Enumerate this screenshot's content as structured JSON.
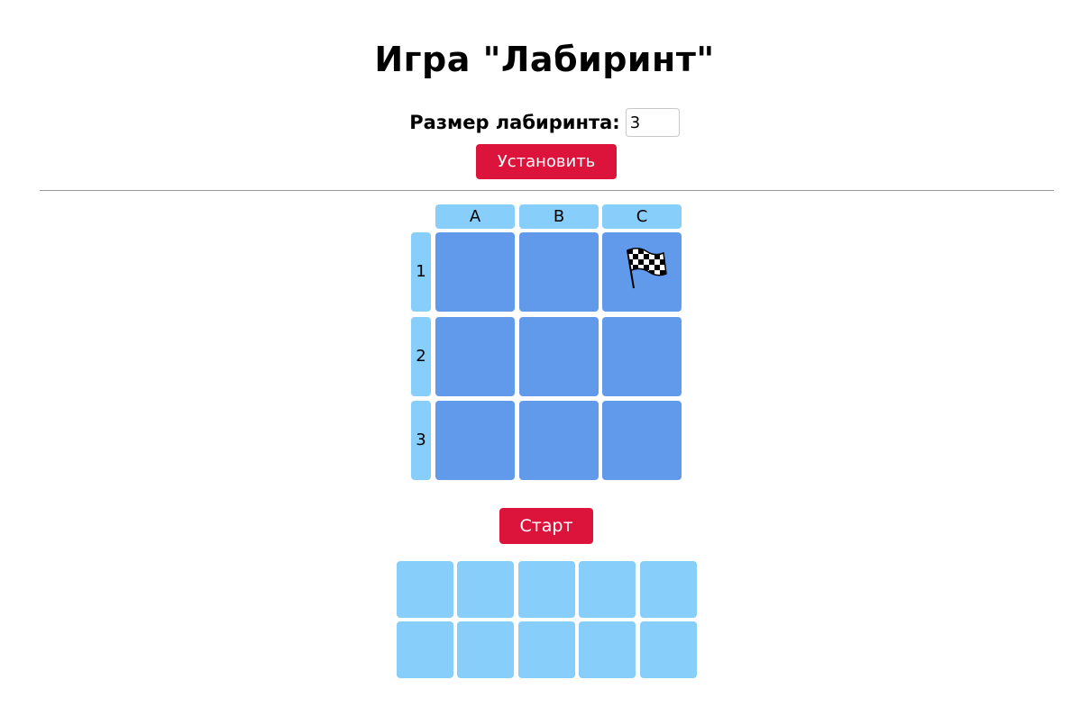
{
  "page": {
    "title": "Игра \"Лабиринт\""
  },
  "settings": {
    "size_label": "Размер лабиринта:",
    "size_value": "3",
    "set_button": "Установить"
  },
  "maze": {
    "columns": [
      "A",
      "B",
      "C"
    ],
    "rows": [
      "1",
      "2",
      "3"
    ],
    "finish": {
      "row": "1",
      "column": "C",
      "icon": "checkered-flag-icon"
    },
    "cell_color": "#6199eb",
    "header_color": "#87cefa"
  },
  "controls": {
    "start_button": "Старт",
    "button_color": "#dc143c"
  },
  "arrow_slots": {
    "rows": 2,
    "columns": 5,
    "filled": 0
  }
}
